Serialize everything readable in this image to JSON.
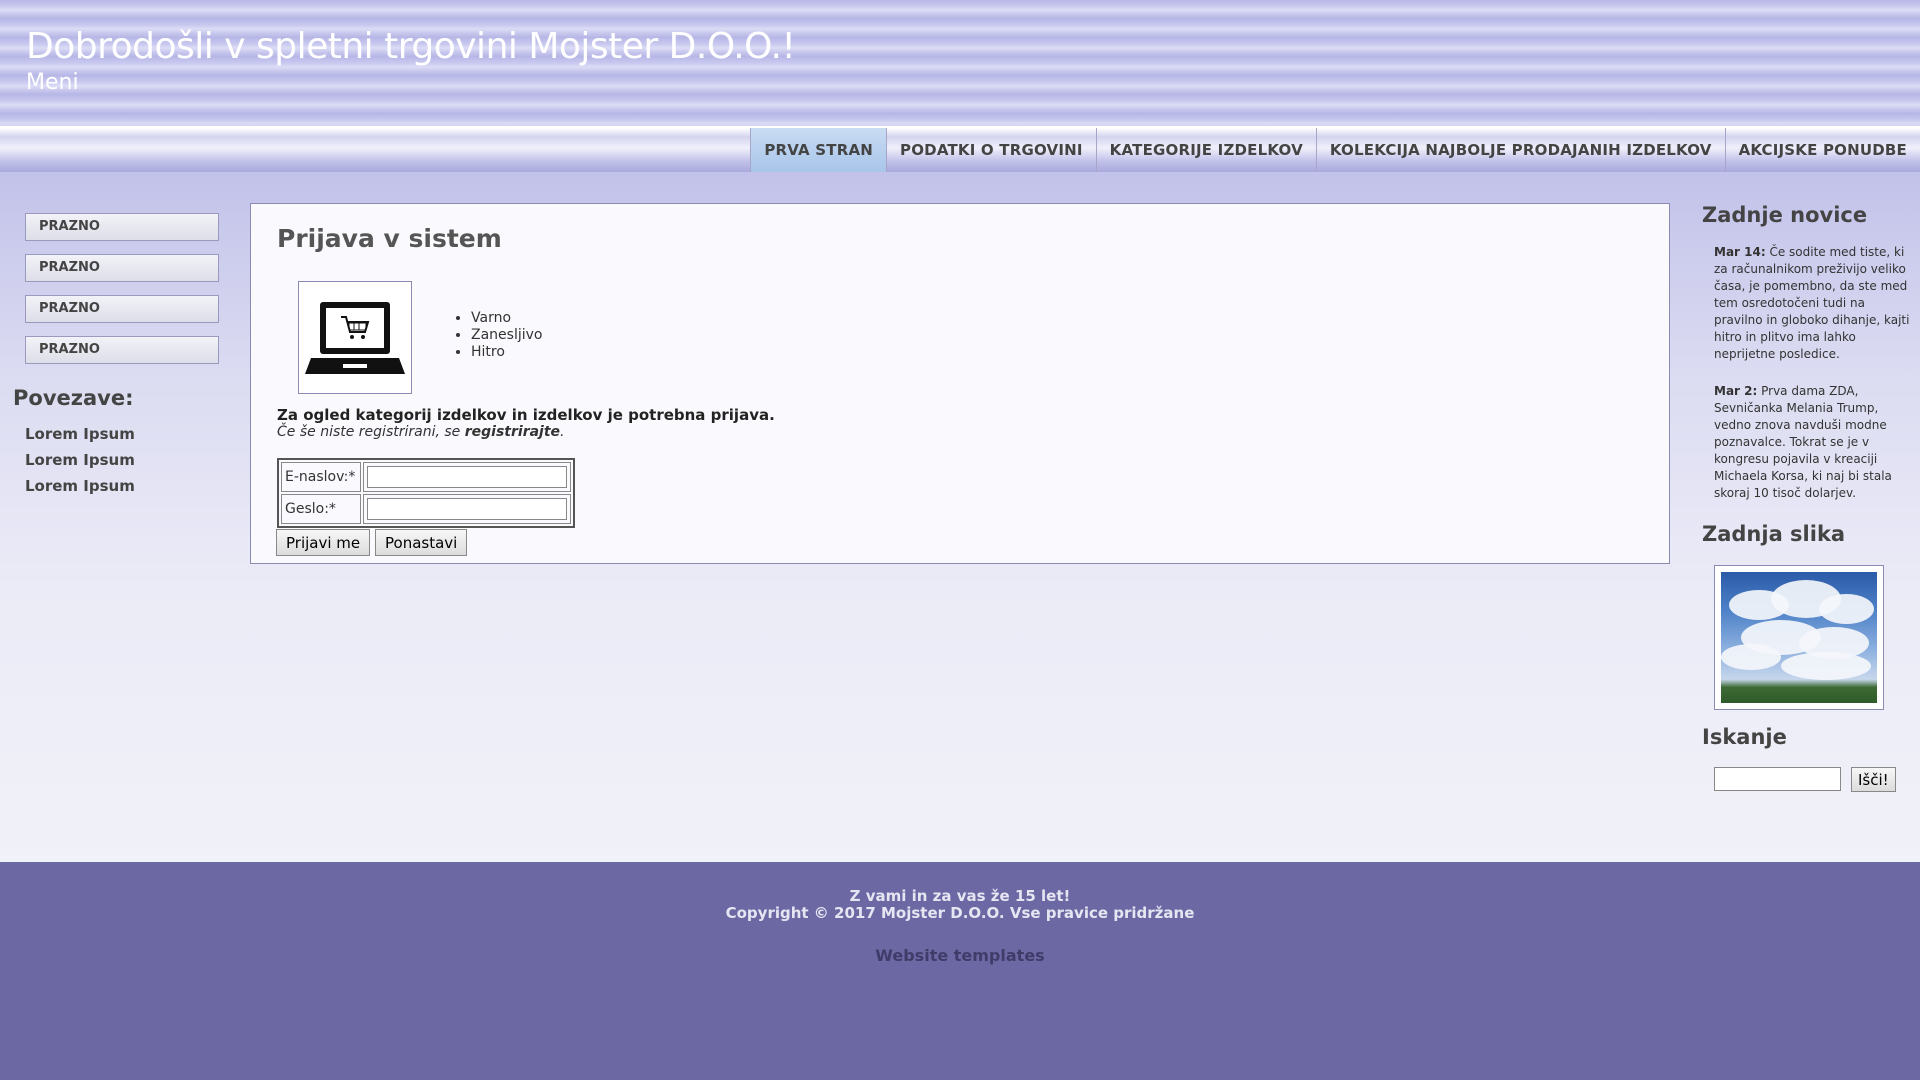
{
  "header": {
    "title": "Dobrodošli v spletni trgovini Mojster D.O.O.!",
    "subtitle": "Meni"
  },
  "nav": {
    "items": [
      {
        "label": "PRVA STRAN",
        "active": true
      },
      {
        "label": "PODATKI O TRGOVINI"
      },
      {
        "label": "KATEGORIJE IZDELKOV"
      },
      {
        "label": "KOLEKCIJA NAJBOLJE PRODAJANIH IZDELKOV"
      },
      {
        "label": "AKCIJSKE PONUDBE"
      }
    ]
  },
  "left_sidebar": {
    "menu": [
      "PRAZNO",
      "PRAZNO",
      "PRAZNO",
      "PRAZNO"
    ],
    "links_title": "Povezave:",
    "links": [
      "Lorem Ipsum",
      "Lorem Ipsum",
      "Lorem Ipsum"
    ]
  },
  "main": {
    "title": "Prijava v sistem",
    "features": [
      "Varno",
      "Zanesljivo",
      "Hitro"
    ],
    "login_note": "Za ogled kategorij izdelkov in izdelkov je potrebna prijava.",
    "register_prefix": "Če še niste registrirani, se ",
    "register_link": "registrirajte",
    "register_suffix": ".",
    "form": {
      "email_label": "E-naslov:*",
      "email_value": "",
      "password_label": "Geslo:*",
      "password_value": "",
      "submit_label": "Prijavi me",
      "reset_label": "Ponastavi"
    }
  },
  "right_sidebar": {
    "news_title": "Zadnje novice",
    "news": [
      {
        "date": "Mar 14:",
        "text": "Če sodite med tiste, ki za računalnikom preživijo veliko časa, je pomembno, da ste med tem osredotočeni tudi na pravilno in globoko dihanje, kajti hitro in plitvo ima lahko neprijetne posledice."
      },
      {
        "date": "Mar 2:",
        "text": "Prva dama ZDA, Sevničanka Melania Trump, vedno znova navduši modne poznavalce. Tokrat se je v kongresu pojavila v kreaciji Michaela Korsa, ki naj bi stala skoraj 10 tisoč dolarjev."
      }
    ],
    "photo_title": "Zadnja slika",
    "search_title": "Iskanje",
    "search_value": "",
    "search_button": "Išči!"
  },
  "footer": {
    "line1": "Z vami in za vas že 15 let!",
    "line2": "Copyright © 2017 Mojster D.O.O. Vse pravice pridržane",
    "link": "Website templates"
  },
  "colors": {
    "footer_bg": "#6c68a4",
    "nav_active": "#b4cdee",
    "text": "#444444"
  },
  "icons": {
    "laptop": "laptop-cart-icon"
  }
}
